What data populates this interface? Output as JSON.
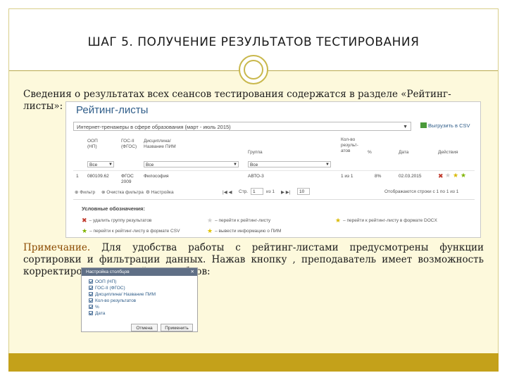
{
  "slide": {
    "title": "ШАГ 5. ПОЛУЧЕНИЕ РЕЗУЛЬТАТОВ ТЕСТИРОВАНИЯ",
    "paragraph1_line1": "Сведения о результатах всех сеансов тестирования содержатся в разделе «Рейтинг-",
    "paragraph1_line2": "листы»:",
    "note_label": "Примечание.",
    "note_text": " Для удобства работы с рейтинг-листами предусмотрены функции сортировки и фильтрации данных. Нажав кнопку , преподаватель имеет возможность корректировать настройку столбцов:",
    "accent_color": "#c4a11a"
  },
  "rating_screen": {
    "title": "Рейтинг-листы",
    "period_value": "Интернет-тренажеры в сфере образования (март - июль 2015)",
    "export_label": "Выгрузить в CSV",
    "columns": {
      "oop": "ООП\n(НП)",
      "gos": "ГОС-II\n(ФГОС)",
      "discipline": "Дисциплина/\nНазвание ПИМ",
      "group": "Группа",
      "count": "Кол-во\nрезульт-\nатов",
      "percent": "%",
      "date": "Дата",
      "actions": "Действия"
    },
    "filter_all": "Все",
    "row": {
      "num": "1",
      "oop": "080109.62",
      "gos": "ФГОС\n2009",
      "discipline": "Философия",
      "group": "АВТО-3",
      "count": "1 из 1",
      "percent": "8%",
      "date": "02.03.2015"
    },
    "footer": {
      "filter": "Фильтр",
      "reset_filter": "Очистка фильтра",
      "settings": "Настройка",
      "page_prefix": "Стр.",
      "page_value": "1",
      "page_suffix": "из 1",
      "per_page": "10",
      "shown": "Отображаются строки с 1 по 1 из 1"
    },
    "legend": {
      "title": "Условные обозначения:",
      "delete": "– удалить группу результатов",
      "open": "– перейти к рейтинг-листу",
      "open_docx": "– перейти к рейтинг-листу в формате DOCX",
      "open_csv": "– перейти к рейтинг-листу в формате CSV",
      "pim_info": "– вывести информацию о ПИМ"
    }
  },
  "column_settings": {
    "title": "Настройка столбцов",
    "options": [
      "ООП (НП)",
      "ГОС-II (ФГОС)",
      "Дисциплина/ Название ПИМ",
      "Кол-во результатов",
      "%",
      "Дата"
    ],
    "cancel": "Отмена",
    "apply": "Применить"
  }
}
